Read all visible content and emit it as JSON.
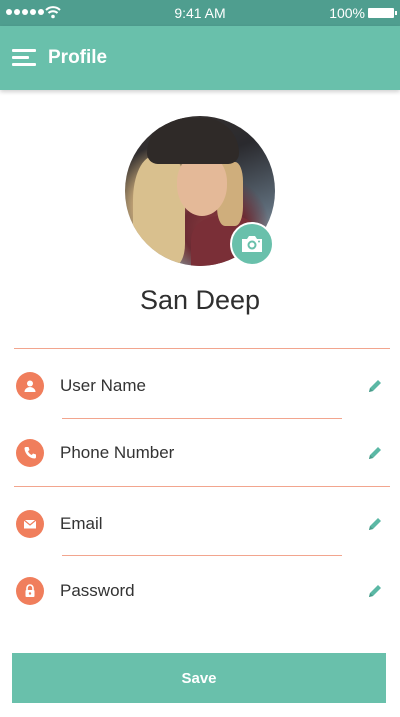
{
  "status_bar": {
    "time": "9:41 AM",
    "battery_pct": "100%"
  },
  "app_bar": {
    "title": "Profile",
    "icon": "menu-icon"
  },
  "profile": {
    "name": "San Deep",
    "avatar_icon": "camera-icon"
  },
  "fields": [
    {
      "label": "User Name",
      "icon": "user-icon"
    },
    {
      "label": "Phone Number",
      "icon": "phone-icon"
    },
    {
      "label": "Email",
      "icon": "mail-icon"
    },
    {
      "label": "Password",
      "icon": "lock-icon"
    }
  ],
  "actions": {
    "save_label": "Save"
  },
  "colors": {
    "primary": "#69c0ab",
    "status_bar": "#4f9e8f",
    "accent": "#f07e5c",
    "divider": "#f2a58e",
    "edit_icon": "#5bb8a5"
  }
}
